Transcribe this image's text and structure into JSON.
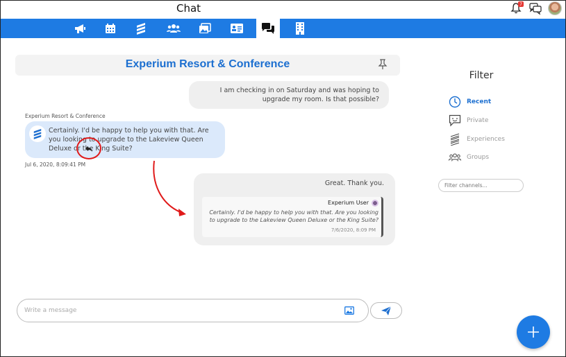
{
  "app": {
    "title": "Chat",
    "notification_count": "7"
  },
  "nav": {
    "items": [
      {
        "name": "announcements",
        "icon": "megaphone-icon"
      },
      {
        "name": "calendar",
        "icon": "calendar-icon"
      },
      {
        "name": "experiences",
        "icon": "experium-logo-icon"
      },
      {
        "name": "groups",
        "icon": "users-icon"
      },
      {
        "name": "gallery",
        "icon": "image-gallery-icon"
      },
      {
        "name": "contacts",
        "icon": "id-card-icon"
      },
      {
        "name": "chat",
        "icon": "chat-icon",
        "active": true
      },
      {
        "name": "properties",
        "icon": "building-icon"
      }
    ]
  },
  "conversation": {
    "title": "Experium Resort & Conference",
    "outgoing_message": "I am checking in on Saturday and was hoping to upgrade my room. Is that possible?",
    "incoming": {
      "sender": "Experium Resort & Conference",
      "text": "Certainly. I'd be happy to help you with that. Are you looking to upgrade to the Lakeview Queen Deluxe or the King Suite?",
      "timestamp": "Jul 6, 2020, 8:09:41 PM"
    },
    "reply": {
      "text": "Great. Thank you.",
      "quoted_user": "Experium User",
      "quoted_text": "Certainly. I'd be happy to help you with that. Are you looking to upgrade to the Lakeview Queen Deluxe or the King Suite?",
      "quoted_time": "7/6/2020, 8:09 PM"
    }
  },
  "filter": {
    "title": "Filter",
    "items": [
      {
        "label": "Recent",
        "icon": "clock-icon",
        "active": true
      },
      {
        "label": "Private",
        "icon": "private-message-icon",
        "active": false
      },
      {
        "label": "Experiences",
        "icon": "experium-logo-icon",
        "active": false
      },
      {
        "label": "Groups",
        "icon": "groups-icon",
        "active": false
      }
    ],
    "search_placeholder": "Filter channels..."
  },
  "composer": {
    "placeholder": "Write a message"
  },
  "colors": {
    "accent": "#1e7be3",
    "title": "#1c6fd0",
    "annotation": "#e01a1a"
  }
}
